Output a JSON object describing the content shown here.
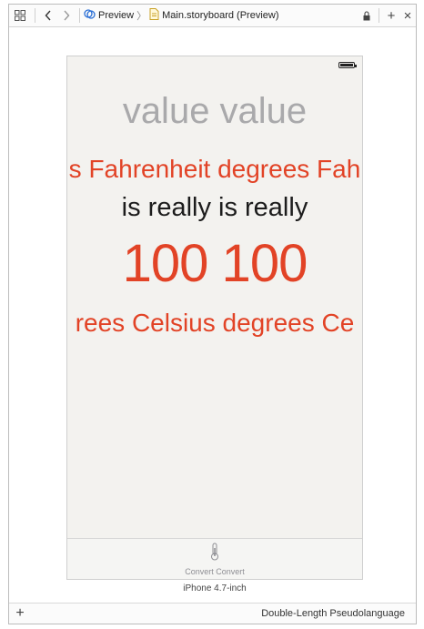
{
  "toolbar": {
    "breadcrumb_preview": "Preview",
    "breadcrumb_file": "Main.storyboard (Preview)"
  },
  "preview": {
    "value_line": "value value",
    "fahrenheit_line": "s Fahrenheit degrees Fah",
    "really_line": "is really is really",
    "number_line": "100 100",
    "celsius_line": "rees Celsius degrees Ce",
    "tab_label": "Convert Convert",
    "device_name": "iPhone 4.7-inch"
  },
  "bottombar": {
    "language": "Double-Length Pseudolanguage"
  },
  "colors": {
    "accent_red": "#e24326",
    "value_gray": "#a9a9ab"
  }
}
